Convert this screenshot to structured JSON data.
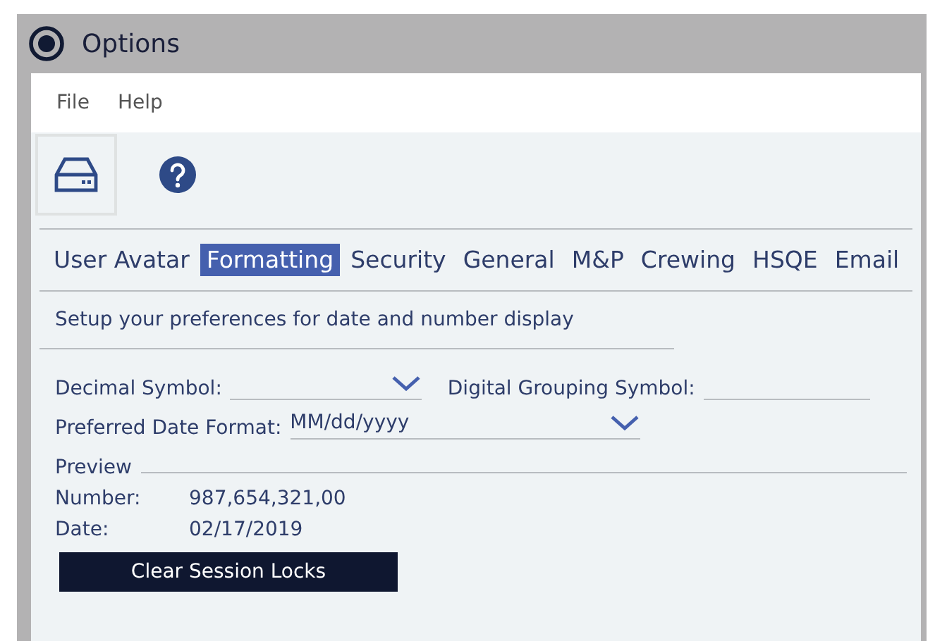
{
  "window": {
    "title": "Options"
  },
  "menu": [
    "File",
    "Help"
  ],
  "toolbar": [
    {
      "kind": "drive",
      "selected": true
    },
    {
      "kind": "help",
      "selected": false
    }
  ],
  "tabs": [
    {
      "label": "User Avatar",
      "selected": false
    },
    {
      "label": "Formatting",
      "selected": true
    },
    {
      "label": "Security",
      "selected": false
    },
    {
      "label": "General",
      "selected": false
    },
    {
      "label": "M&P",
      "selected": false
    },
    {
      "label": "Crewing",
      "selected": false
    },
    {
      "label": "HSQE",
      "selected": false
    },
    {
      "label": "Email",
      "selected": false
    }
  ],
  "description": "Setup your preferences for date and number display",
  "decimal_symbol": {
    "label": "Decimal Symbol:"
  },
  "grouping_symbol": {
    "label": "Digital Grouping Symbol:"
  },
  "date_format": {
    "label": "Preferred Date Format:",
    "value": "MM/dd/yyyy"
  },
  "preview": {
    "label": "Preview",
    "rows": [
      {
        "label": "Number:",
        "value": "987,654,321,00"
      },
      {
        "label": "Date:",
        "value": "02/17/2019"
      }
    ]
  },
  "button": "Clear Session Locks"
}
